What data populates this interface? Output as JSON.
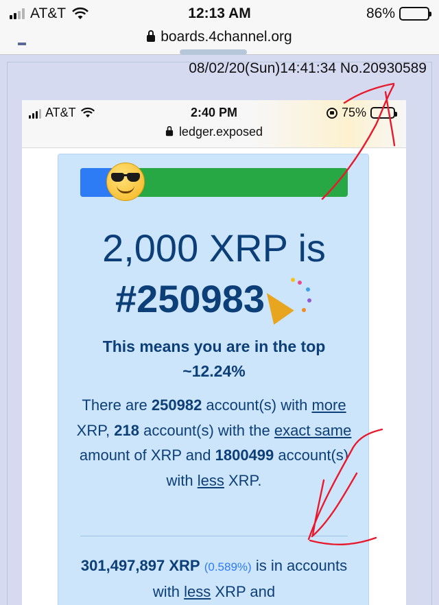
{
  "outer_status": {
    "carrier": "AT&T",
    "time": "12:13 AM",
    "battery": "86%",
    "url": "boards.4channel.org"
  },
  "post": {
    "datetime": "08/02/20(Sun)14:41:34",
    "number": "No.20930589"
  },
  "inner_status": {
    "carrier": "AT&T",
    "time": "2:40 PM",
    "battery": "75%",
    "url": "ledger.exposed"
  },
  "card": {
    "progress_fraction": 0.1224,
    "headline_line1": "2,000 XRP is",
    "headline_line2": "#250983",
    "subhead_line1": "This means you are in the top",
    "subhead_line2": "~12.24%",
    "p1": {
      "t1": "There are ",
      "more_count": "250982",
      "t2": " account(s) with ",
      "more_link": "more",
      "t3": " XRP, ",
      "same_count": "218",
      "t4": " account(s) with the ",
      "same_link": "exact same",
      "t5": " amount of XRP and ",
      "less_count": "1800499",
      "t6": " account(s) with ",
      "less_link": "less",
      "t7": " XRP."
    },
    "p2": {
      "amount": "301,497,897 XRP",
      "percent": "(0.589%)",
      "t1": " is in accounts with ",
      "less_link": "less",
      "t2": " XRP and"
    }
  },
  "icons": [
    "signal-icon",
    "wifi-icon",
    "battery-icon",
    "lock-icon",
    "rotation-lock-icon",
    "sunglasses-emoji",
    "party-popper-emoji"
  ],
  "colors": {
    "card_bg": "#cde5fb",
    "text_navy": "#0c3e78",
    "progress_blue": "#2e7bf6",
    "progress_green": "#28a745",
    "annotation_red": "#e8192c"
  }
}
